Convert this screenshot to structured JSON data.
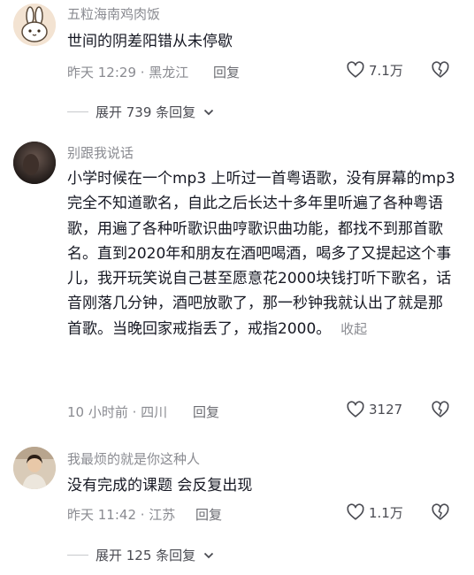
{
  "comments": [
    {
      "username": "五粒海南鸡肉饭",
      "text": "世间的阴差阳错从未停歇",
      "time_location": "昨天 12:29 · 黑龙江",
      "reply_label": "回复",
      "likes": "7.1万",
      "expand_label": "展开 739 条回复"
    },
    {
      "username": "别跟我说话",
      "text": "小学时候在一个mp3 上听过一首粤语歌，没有屏幕的mp3 完全不知道歌名，自此之后长达十多年里听遍了各种粤语歌，用遍了各种听歌识曲哼歌识曲功能，都找不到那首歌名。直到2020年和朋友在酒吧喝酒，喝多了又提起这个事儿，我开玩笑说自己甚至愿意花2000块钱打听下歌名，话音刚落几分钟，酒吧放歌了，那一秒钟我就认出了就是那首歌。当晚回家戒指丢了，戒指2000。",
      "collapse_label": "收起",
      "time_location": "10 小时前 · 四川",
      "reply_label": "回复",
      "likes": "3127"
    },
    {
      "username": "我最烦的就是你这种人",
      "text": "没有完成的课题 会反复出现",
      "time_location": "昨天 11:42 · 江苏",
      "reply_label": "回复",
      "likes": "1.1万",
      "expand_label": "展开 125 条回复"
    }
  ]
}
